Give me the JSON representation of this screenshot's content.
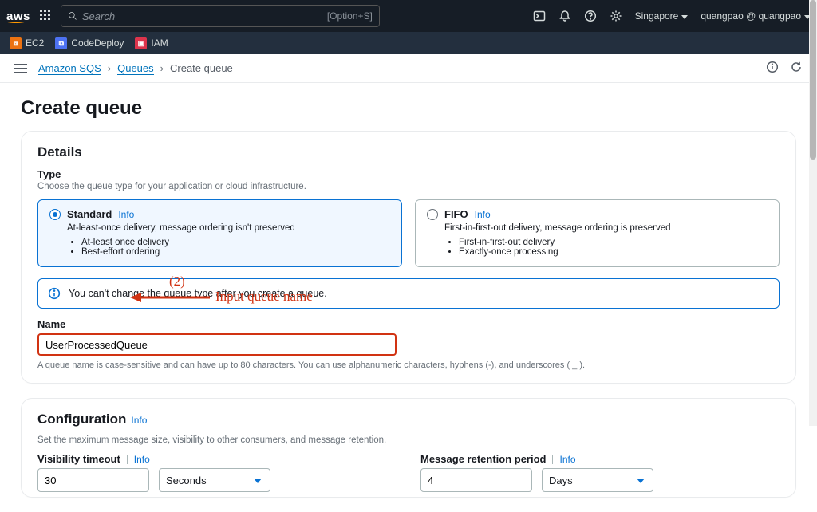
{
  "topbar": {
    "search_placeholder": "Search",
    "search_hint": "[Option+S]",
    "region": "Singapore",
    "user": "quangpao @ quangpao"
  },
  "favorites": {
    "ec2": "EC2",
    "codedeploy": "CodeDeploy",
    "iam": "IAM"
  },
  "breadcrumbs": {
    "service": "Amazon SQS",
    "level1": "Queues",
    "current": "Create queue"
  },
  "page": {
    "title": "Create queue"
  },
  "details": {
    "panel_title": "Details",
    "type_label": "Type",
    "type_hint": "Choose the queue type for your application or cloud infrastructure.",
    "standard": {
      "label": "Standard",
      "info": "Info",
      "sub": "At-least-once delivery, message ordering isn't preserved",
      "bullet1": "At-least once delivery",
      "bullet2": "Best-effort ordering"
    },
    "fifo": {
      "label": "FIFO",
      "info": "Info",
      "sub": "First-in-first-out delivery, message ordering is preserved",
      "bullet1": "First-in-first-out delivery",
      "bullet2": "Exactly-once processing"
    },
    "alert": "You can't change the queue type after you create a queue.",
    "name_label": "Name",
    "name_value": "UserProcessedQueue",
    "name_hint": "A queue name is case-sensitive and can have up to 80 characters. You can use alphanumeric characters, hyphens (-), and underscores ( _ )."
  },
  "config": {
    "panel_title": "Configuration",
    "info": "Info",
    "sub": "Set the maximum message size, visibility to other consumers, and message retention.",
    "visibility": {
      "label": "Visibility timeout",
      "info": "Info",
      "value": "30",
      "unit": "Seconds"
    },
    "retention": {
      "label": "Message retention period",
      "info": "Info",
      "value": "4",
      "unit": "Days"
    }
  },
  "annotation": {
    "step": "(2)",
    "text": "Input queue name"
  }
}
